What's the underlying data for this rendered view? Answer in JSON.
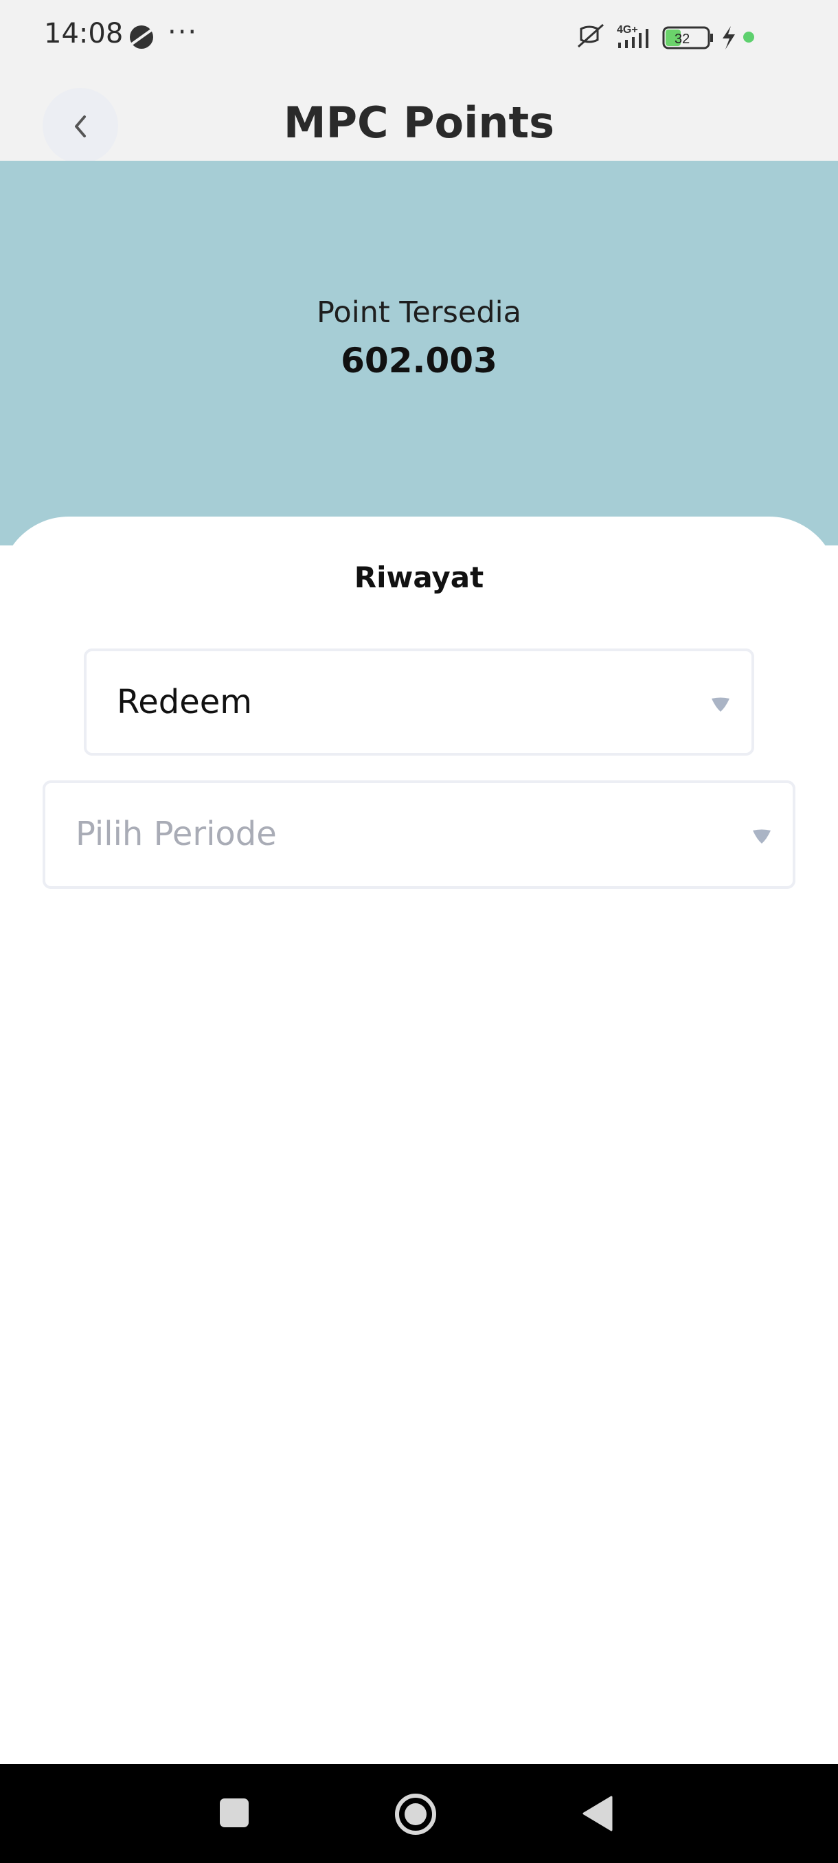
{
  "status_bar": {
    "time": "14:08",
    "dots": "···",
    "battery": "32",
    "icons": [
      "mute-vibrate-icon",
      "signal-4g-icon",
      "battery-icon",
      "charging-icon",
      "dot-icon"
    ]
  },
  "app_bar": {
    "title": "MPC Points",
    "back_icon": "chevron-left-icon"
  },
  "points": {
    "label": "Point Tersedia",
    "value": "602.003"
  },
  "tabs": [
    {
      "label": "Riwayat",
      "active": true
    }
  ],
  "filters": {
    "type": {
      "value": "Redeem"
    },
    "period": {
      "placeholder": "Pilih Periode"
    }
  },
  "colors": {
    "hero": "#a6cdd5",
    "background": "#f2f2f2",
    "battery_fill": "#6bd36b",
    "dot": "#5ed06e"
  }
}
